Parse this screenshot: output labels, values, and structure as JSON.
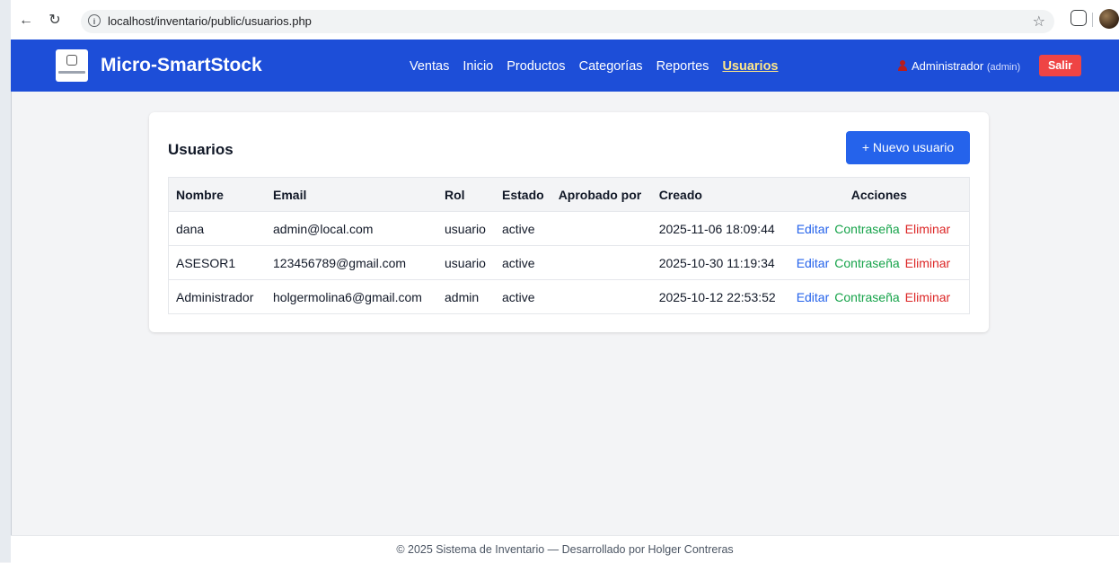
{
  "browser": {
    "url": "localhost/inventario/public/usuarios.php"
  },
  "app": {
    "brand": "Micro-SmartStock",
    "nav": [
      "Ventas",
      "Inicio",
      "Productos",
      "Categorías",
      "Reportes",
      "Usuarios"
    ],
    "active_nav": "Usuarios",
    "user_name": "Administrador",
    "user_role": "(admin)",
    "logout_label": "Salir"
  },
  "page": {
    "title": "Usuarios",
    "new_button": "+ Nuevo usuario",
    "columns": [
      "Nombre",
      "Email",
      "Rol",
      "Estado",
      "Aprobado por",
      "Creado",
      "Acciones"
    ],
    "rows": [
      {
        "nombre": "dana",
        "email": "admin@local.com",
        "rol": "usuario",
        "estado": "active",
        "aprobado_por": "",
        "creado": "2025-11-06 18:09:44"
      },
      {
        "nombre": "ASESOR1",
        "email": "123456789@gmail.com",
        "rol": "usuario",
        "estado": "active",
        "aprobado_por": "",
        "creado": "2025-10-30 11:19:34"
      },
      {
        "nombre": "Administrador",
        "email": "holgermolina6@gmail.com",
        "rol": "admin",
        "estado": "active",
        "aprobado_por": "",
        "creado": "2025-10-12 22:53:52"
      }
    ],
    "actions": {
      "edit": "Editar",
      "password": "Contraseña",
      "delete": "Eliminar"
    }
  },
  "footer": "© 2025 Sistema de Inventario — Desarrollado por Holger Contreras",
  "colors": {
    "nav_bg": "#1d4ed8",
    "primary": "#2563eb",
    "danger": "#ef4444",
    "success": "#16a34a",
    "active_link": "#fde68a"
  }
}
